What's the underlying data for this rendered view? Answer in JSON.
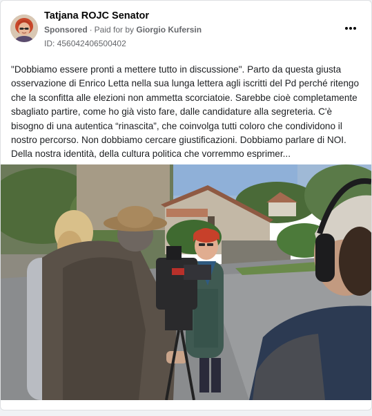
{
  "post": {
    "author": "Tatjana ROJC Senator",
    "sponsored_label": "Sponsored",
    "paid_for_by": "Paid for by",
    "payer": "Giorgio Kufersin",
    "id_line": "ID: 456042406500402",
    "text": "\"Dobbiamo essere pronti a mettere tutto in discussione\". Parto da questa giusta osservazione di Enrico Letta nella sua lunga lettera agli iscritti del Pd perché ritengo che la sconfitta alle elezioni non ammetta scorciatoie. Sarebbe cioè completamente sbagliato partire, come ho già visto fare, dalle candidature alla segreteria. C'è bisogno di una autentica “rinascita”, che coinvolga tutti coloro che condividono il nostro percorso. Non dobbiamo cercare giustificazioni. Dobbiamo parlare di NOI. Della nostra identità, della cultura politica che vorremmo esprimer..."
  },
  "icons": {
    "more": "more-horizontal-icon",
    "avatar": "profile-photo"
  },
  "colors": {
    "card_bg": "#ffffff",
    "page_bg": "#f0f2f5",
    "name": "#050505",
    "meta": "#65676b",
    "text": "#1c1e21",
    "avatar_hair": "#c8472a"
  }
}
